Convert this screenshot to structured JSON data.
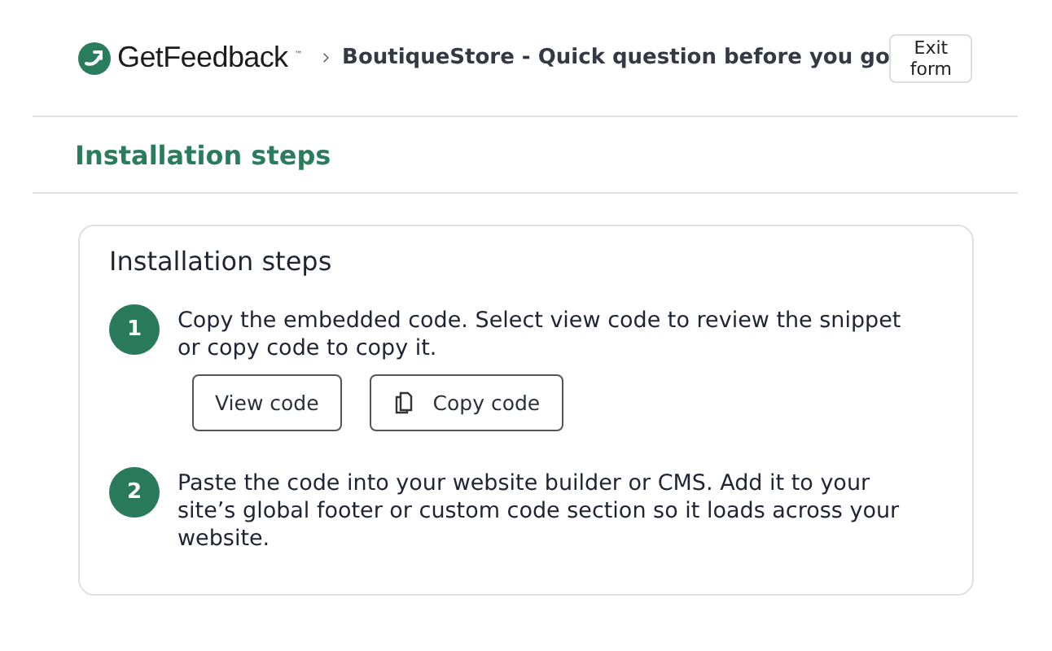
{
  "header": {
    "brand": "GetFeedback",
    "brand_mark": "™",
    "breadcrumb": "BoutiqueStore - Quick question before you go",
    "exit_button": "Exit form"
  },
  "section_title": "Installation steps",
  "card": {
    "title": "Installation steps",
    "steps": [
      {
        "number": "1",
        "text": "Copy the embedded code. Select view code to review the snippet or copy code to copy it.",
        "buttons": [
          {
            "label": "View code",
            "kind": "plain"
          },
          {
            "label": "Copy code",
            "kind": "copy"
          }
        ]
      },
      {
        "number": "2",
        "text": "Paste the code into your website builder or CMS. Add it to your site’s global footer or custom code section so it loads across your website."
      }
    ]
  }
}
